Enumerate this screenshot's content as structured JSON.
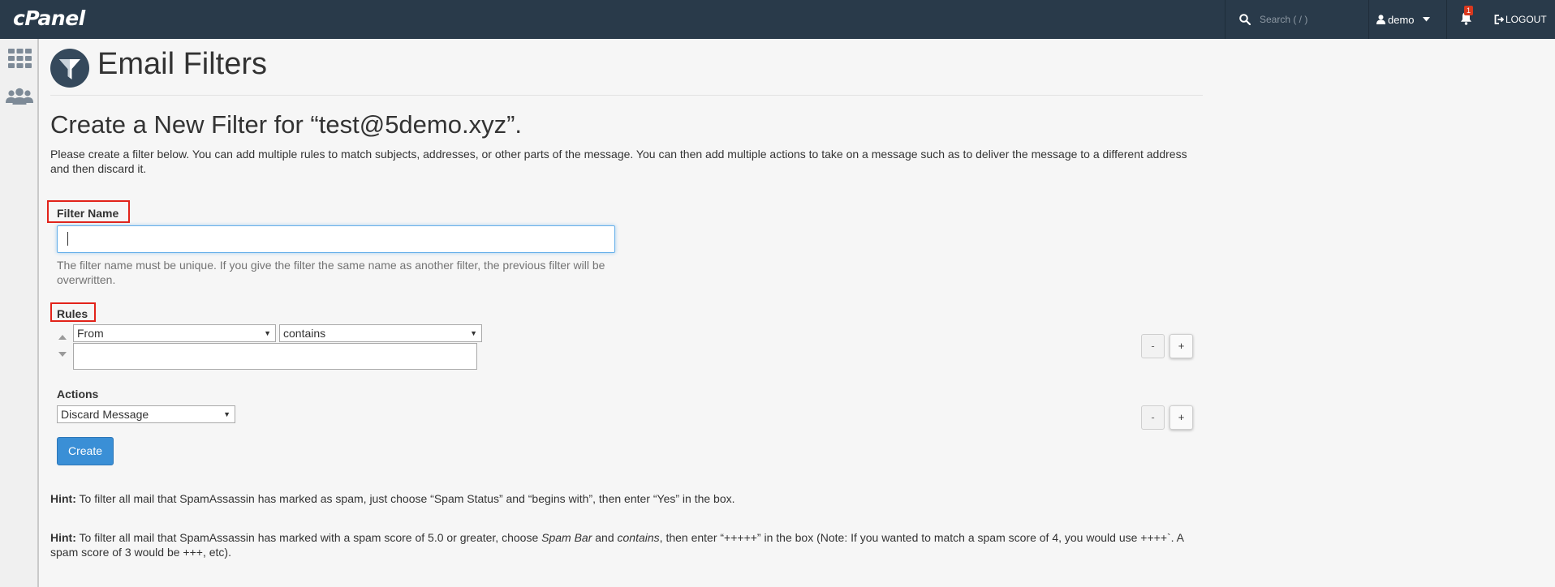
{
  "topbar": {
    "logo": "cPanel",
    "search_placeholder": "Search ( / )",
    "user": "demo",
    "notification_count": "1",
    "logout": "LOGOUT"
  },
  "page": {
    "title": "Email Filters",
    "subtitle": "Create a New Filter for “test@5demo.xyz”.",
    "description": "Please create a filter below. You can add multiple rules to match subjects, addresses, or other parts of the message. You can then add multiple actions to take on a message such as to deliver the message to a different address and then discard it."
  },
  "filter_name": {
    "label": "Filter Name",
    "value": "",
    "help": "The filter name must be unique. If you give the filter the same name as another filter, the previous filter will be overwritten."
  },
  "rules": {
    "label": "Rules",
    "field_select": "From",
    "operator_select": "contains",
    "value": "",
    "remove_label": "-",
    "add_label": "+"
  },
  "actions": {
    "label": "Actions",
    "action_select": "Discard Message",
    "remove_label": "-",
    "add_label": "+"
  },
  "create_button": "Create",
  "hints": [
    {
      "label": "Hint:",
      "text": " To filter all mail that SpamAssassin has marked as spam, just choose “Spam Status” and “begins with”, then enter “Yes” in the box."
    },
    {
      "label": "Hint:",
      "text_a": " To filter all mail that SpamAssassin has marked with a spam score of 5.0 or greater, choose ",
      "em_a": "Spam Bar",
      "text_b": " and ",
      "em_b": "contains",
      "text_c": ", then enter “+++++” in the box (Note: If you wanted to match a spam score of 4, you would use ++++`. A spam score of 3 would be +++, etc)."
    }
  ],
  "colors": {
    "topbar": "#293a4a",
    "highlight_box": "#e2231a",
    "primary_button": "#3a8fd6"
  },
  "icons": [
    "search-icon",
    "user-icon",
    "caret-down-icon",
    "bell-icon",
    "logout-icon",
    "apps-grid-icon",
    "users-icon",
    "funnel-icon"
  ]
}
